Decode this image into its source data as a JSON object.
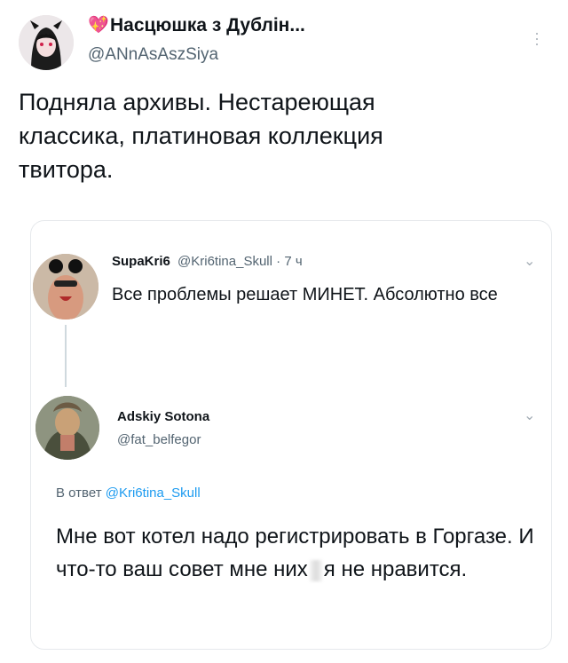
{
  "main_tweet": {
    "emoji": "💖",
    "display_name": "Насцюшка з Дублін...",
    "handle": "@ANnAsAszSiya",
    "text": "Подняла архивы. Нестареющая классика, платиновая коллекция твитора."
  },
  "quoted_thread": {
    "first": {
      "display_name": "SupaKri6",
      "handle": "@Kri6tina_Skull",
      "separator": "·",
      "time": "7 ч",
      "text": "Все проблемы решает МИНЕТ. Абсолютно все"
    },
    "reply": {
      "display_name": "Adskiy Sotona",
      "handle": "@fat_belfegor",
      "reply_prefix": "В ответ",
      "reply_to": "@Kri6tina_Skull",
      "text_before": "Мне вот котел надо регистрировать в Горгазе. И что-то ваш совет мне них",
      "text_after": "я не нравится."
    }
  },
  "icons": {
    "more": "more-vertical-icon",
    "chevron": "chevron-down-icon"
  },
  "colors": {
    "text": "#0f1419",
    "secondary": "#536471",
    "link": "#1d9bf0",
    "border": "#e6e9ec"
  }
}
